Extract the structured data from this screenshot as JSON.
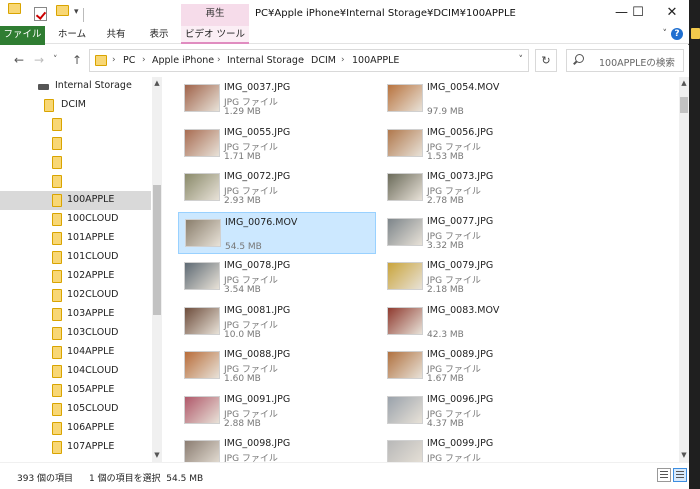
{
  "window": {
    "title": "PC¥Apple iPhone¥Internal Storage¥DCIM¥100APPLE",
    "context_tab": "再生",
    "qa_dropdown": "▾"
  },
  "ribbon": {
    "tabs": [
      "ファイル",
      "ホーム",
      "共有",
      "表示",
      "ビデオ ツール"
    ]
  },
  "address": {
    "crumbs": [
      "PC",
      "Apple iPhone",
      "Internal Storage",
      "DCIM",
      "100APPLE"
    ],
    "separator": "›",
    "search_placeholder": "100APPLEの検索"
  },
  "tree": {
    "drive_label": "Internal Storage",
    "dcim_label": "DCIM",
    "items": [
      "",
      "",
      "",
      "",
      "100APPLE",
      "100CLOUD",
      "101APPLE",
      "101CLOUD",
      "102APPLE",
      "102CLOUD",
      "103APPLE",
      "103CLOUD",
      "104APPLE",
      "104CLOUD",
      "105APPLE",
      "105CLOUD",
      "106APPLE",
      "107APPLE"
    ],
    "selected": "100APPLE"
  },
  "files": [
    {
      "name": "IMG_0037.JPG",
      "type": "JPG ファイル",
      "size": "1.29 MB",
      "color": "#a0634a"
    },
    {
      "name": "IMG_0054.MOV",
      "type": "",
      "size": "97.9 MB",
      "color": "#b8733e"
    },
    {
      "name": "IMG_0055.JPG",
      "type": "JPG ファイル",
      "size": "1.71 MB",
      "color": "#a86c52"
    },
    {
      "name": "IMG_0056.JPG",
      "type": "JPG ファイル",
      "size": "1.53 MB",
      "color": "#b0784c"
    },
    {
      "name": "IMG_0072.JPG",
      "type": "JPG ファイル",
      "size": "2.93 MB",
      "color": "#8a8a6a"
    },
    {
      "name": "IMG_0073.JPG",
      "type": "JPG ファイル",
      "size": "2.78 MB",
      "color": "#6b6b5a"
    },
    {
      "name": "IMG_0076.MOV",
      "type": "",
      "size": "54.5 MB",
      "color": "#8a7e6c"
    },
    {
      "name": "IMG_0077.JPG",
      "type": "JPG ファイル",
      "size": "3.32 MB",
      "color": "#7d858a"
    },
    {
      "name": "IMG_0078.JPG",
      "type": "JPG ファイル",
      "size": "3.54 MB",
      "color": "#5e6a74"
    },
    {
      "name": "IMG_0079.JPG",
      "type": "JPG ファイル",
      "size": "2.18 MB",
      "color": "#c9a43b"
    },
    {
      "name": "IMG_0081.JPG",
      "type": "JPG ファイル",
      "size": "10.0 MB",
      "color": "#6e4d3c"
    },
    {
      "name": "IMG_0083.MOV",
      "type": "",
      "size": "42.3 MB",
      "color": "#8f3a2f"
    },
    {
      "name": "IMG_0088.JPG",
      "type": "JPG ファイル",
      "size": "1.60 MB",
      "color": "#b86d3a"
    },
    {
      "name": "IMG_0089.JPG",
      "type": "JPG ファイル",
      "size": "1.67 MB",
      "color": "#b0713f"
    },
    {
      "name": "IMG_0091.JPG",
      "type": "JPG ファイル",
      "size": "2.88 MB",
      "color": "#b0586a"
    },
    {
      "name": "IMG_0096.JPG",
      "type": "JPG ファイル",
      "size": "4.37 MB",
      "color": "#9aa2ab"
    },
    {
      "name": "IMG_0098.JPG",
      "type": "JPG ファイル",
      "size": "",
      "color": "#8b7d72"
    },
    {
      "name": "IMG_0099.JPG",
      "type": "JPG ファイル",
      "size": "",
      "color": "#b8b8b8"
    }
  ],
  "selected_file": "IMG_0076.MOV",
  "status": {
    "count": "393 個の項目",
    "selection": "1 個の項目を選択  54.5 MB"
  },
  "icons": {
    "back": "←",
    "forward": "→",
    "recent": "˅",
    "up": "↑",
    "refresh": "↻",
    "minimize": "—",
    "maximize": "☐",
    "close": "✕",
    "expand": "˅",
    "help": "?",
    "scroll_up": "▲",
    "scroll_down": "▼",
    "address_dropdown": "˅"
  }
}
